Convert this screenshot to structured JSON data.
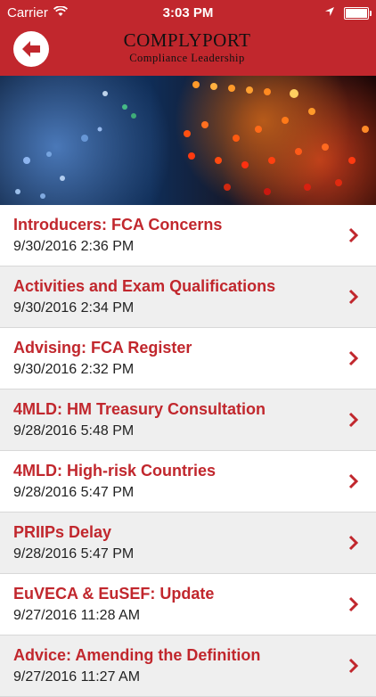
{
  "status_bar": {
    "carrier": "Carrier",
    "time": "3:03 PM",
    "icons": [
      "wifi-icon",
      "location-icon",
      "battery-icon"
    ]
  },
  "header": {
    "back_icon": "back-arrow-icon",
    "brand_title": "COMPLYPORT",
    "brand_subtitle": "Compliance Leadership"
  },
  "colors": {
    "brand_red": "#c1272d",
    "alt_row": "#efefef"
  },
  "articles": [
    {
      "title": "Introducers: FCA Concerns",
      "date": "9/30/2016 2:36 PM"
    },
    {
      "title": "Activities and Exam Qualifications",
      "date": "9/30/2016 2:34 PM"
    },
    {
      "title": "Advising: FCA Register",
      "date": "9/30/2016 2:32 PM"
    },
    {
      "title": "4MLD: HM Treasury Consultation",
      "date": "9/28/2016 5:48 PM"
    },
    {
      "title": "4MLD: High-risk Countries",
      "date": "9/28/2016 5:47 PM"
    },
    {
      "title": "PRIIPs Delay",
      "date": "9/28/2016 5:47 PM"
    },
    {
      "title": "EuVECA & EuSEF: Update",
      "date": "9/27/2016 11:28 AM"
    },
    {
      "title": "Advice: Amending the Definition",
      "date": "9/27/2016 11:27 AM"
    }
  ]
}
